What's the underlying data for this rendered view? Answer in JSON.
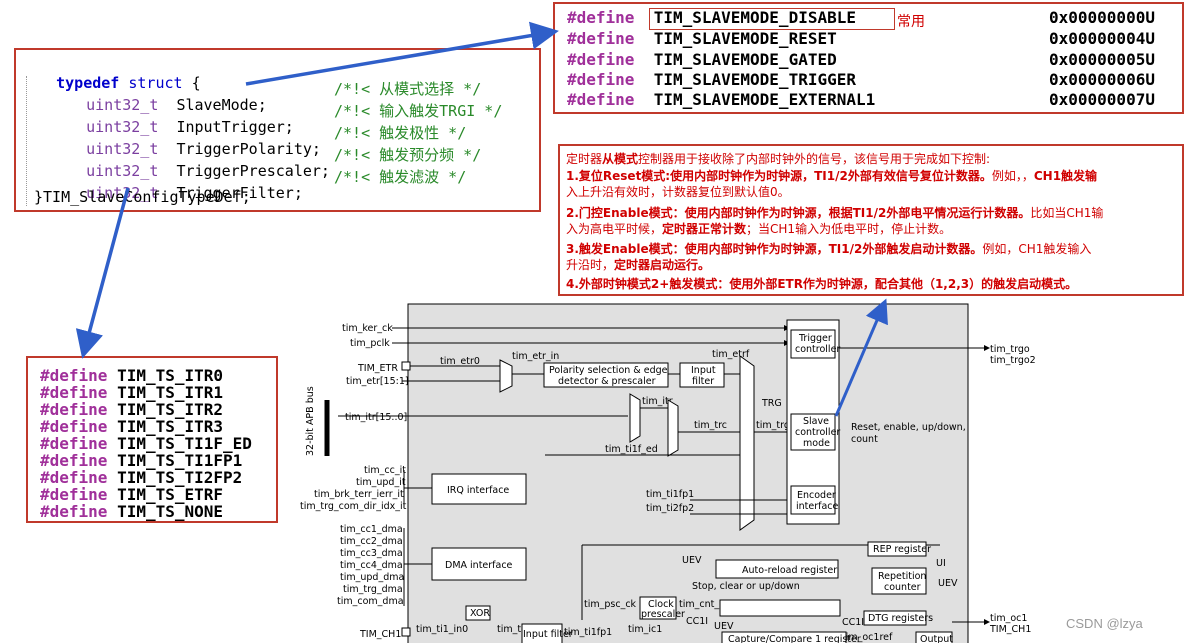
{
  "struct_box": {
    "typedef": "typedef",
    "struct": "struct",
    "brace_open": "{",
    "fields": [
      {
        "type": "uint32_t",
        "name": "SlaveMode;",
        "comment": "/*!< 从模式选择 */"
      },
      {
        "type": "uint32_t",
        "name": "InputTrigger;",
        "comment": "/*!< 输入触发TRGI */"
      },
      {
        "type": "uint32_t",
        "name": "TriggerPolarity;",
        "comment": "/*!< 触发极性 */"
      },
      {
        "type": "uint32_t",
        "name": "TriggerPrescaler;",
        "comment": "/*!< 触发预分频 */"
      },
      {
        "type": "uint32_t",
        "name": "TriggerFilter;",
        "comment": "/*!< 触发滤波 */"
      }
    ],
    "closing": "}TIM_SlaveConfigTypeDef;"
  },
  "slavemode_box": {
    "defines": [
      {
        "kw": "#define",
        "name": "TIM_SLAVEMODE_DISABLE",
        "value": "0x00000000U"
      },
      {
        "kw": "#define",
        "name": "TIM_SLAVEMODE_RESET",
        "value": "0x00000004U"
      },
      {
        "kw": "#define",
        "name": "TIM_SLAVEMODE_GATED",
        "value": "0x00000005U"
      },
      {
        "kw": "#define",
        "name": "TIM_SLAVEMODE_TRIGGER",
        "value": "0x00000006U"
      },
      {
        "kw": "#define",
        "name": "TIM_SLAVEMODE_EXTERNAL1",
        "value": "0x00000007U"
      }
    ],
    "note": "常用"
  },
  "ts_box": {
    "defines": [
      {
        "kw": "#define",
        "name": "TIM_TS_ITR0"
      },
      {
        "kw": "#define",
        "name": "TIM_TS_ITR1"
      },
      {
        "kw": "#define",
        "name": "TIM_TS_ITR2"
      },
      {
        "kw": "#define",
        "name": "TIM_TS_ITR3"
      },
      {
        "kw": "#define",
        "name": "TIM_TS_TI1F_ED"
      },
      {
        "kw": "#define",
        "name": "TIM_TS_TI1FP1"
      },
      {
        "kw": "#define",
        "name": "TIM_TS_TI2FP2"
      },
      {
        "kw": "#define",
        "name": "TIM_TS_ETRF"
      },
      {
        "kw": "#define",
        "name": "TIM_TS_NONE"
      }
    ]
  },
  "desc_box": {
    "intro_a": "定时器",
    "intro_b": "从模式",
    "intro_c": "控制器用于接收除了内部时钟外的信号，该信号用于完成如下控制:",
    "l1a": "1.复位Reset模式:使用内部时钟作为时钟源，TI1/2外部有效信号复位计数器。",
    "l1b": "例如，，",
    "l1c": "CH1触发输",
    "l2": "入上升沿有效时，计数器复位到默认值0。",
    "l3a": "2.门控Enable模式：使用内部时钟作为时钟源，根据TI1/2外部电平情况运行计数器。",
    "l3b": "比如当CH1输",
    "l4a": "入为高电平时候，",
    "l4b": "定时器正常计数",
    "l4c": "；当CH1输入为低电平时，停止计数。",
    "l5a": "3.触发Enable模式：使用内部时钟作为时钟源，",
    "l5b": "TI1/2外部触发启动计数器。",
    "l5c": "例如，CH1触发输入",
    "l6a": "升沿时，",
    "l6b": "定时器启动运行。",
    "l7": "4.外部时钟模式2+触发模式：使用外部ETR作为时钟源，配合其他（1,2,3）的触发启动模式。"
  },
  "diagram": {
    "inputs": {
      "tim_ker_ck": "tim_ker_ck",
      "tim_pclk": "tim_pclk",
      "tim_etr": "TIM_ETR",
      "tim_etr_bus": "tim_etr[15:1]",
      "tim_itr": "tim_itr[15..0]",
      "bus": "32-bit APB bus",
      "tim_cc_it": "tim_cc_it",
      "tim_upd_it": "tim_upd_it",
      "tim_brk": "tim_brk_terr_ierr_it",
      "tim_trg_com": "tim_trg_com_dir_idx_it",
      "tim_cc1_dma": "tim_cc1_dma",
      "tim_cc2_dma": "tim_cc2_dma",
      "tim_cc3_dma": "tim_cc3_dma",
      "tim_cc4_dma": "tim_cc4_dma",
      "tim_upd_dma": "tim_upd_dma",
      "tim_trg_dma": "tim_trg_dma",
      "tim_com_dma": "tim_com_dma",
      "tim_ch1": "TIM_CH1"
    },
    "signals": {
      "tim_etr0": "tim_etr0",
      "tim_etr_in": "tim_etr_in",
      "tim_etrf": "tim_etrf",
      "tim_itr_sig": "tim_itr",
      "tim_trc": "tim_trc",
      "tim_ti1f_ed": "tim_ti1f_ed",
      "tim_ti1fp1": "tim_ti1fp1",
      "tim_ti2fp2": "tim_ti2fp2",
      "trg": "TRG",
      "tim_trgi": "tim_trgi",
      "reset_label": "Reset, enable, up/down,",
      "count_label": "count",
      "uev": "UEV",
      "stop_label": "Stop, clear or up/down",
      "ui": "UI",
      "uev2": "UEV",
      "tim_psc_ck": "tim_psc_ck",
      "tim_cnt_ck": "tim_cnt_ck",
      "cc1i": "CC1I",
      "uev3": "UEV",
      "cc1i_b": "CC1I",
      "tim_ti1_in0": "tim_ti1_in0",
      "tim_ti1": "tim_ti1",
      "tim_ti1fp1_b": "tim_ti1fp1",
      "tim_ic1": "tim_ic1",
      "tim_oc1ref": "tim_oc1ref"
    },
    "blocks": {
      "polarity1": "Polarity selection & edge",
      "polarity2": "detector & prescaler",
      "input_filter1": "Input",
      "input_filter2": "filter",
      "trigger_ctrl1": "Trigger",
      "trigger_ctrl2": "controller",
      "slave1": "Slave",
      "slave2": "controller",
      "slave3": "mode",
      "encoder1": "Encoder",
      "encoder2": "interface",
      "irq": "IRQ interface",
      "dma": "DMA interface",
      "autoreload": "Auto-reload register",
      "rep_reg": "REP register",
      "rep_cnt1": "Repetition",
      "rep_cnt2": "counter",
      "clock_psc1": "Clock",
      "clock_psc2": "prescaler",
      "dtg": "DTG registers",
      "xor": "XOR",
      "input_filter_b": "Input filter",
      "ccr": "Capture/Compare 1 register",
      "output": "Output"
    },
    "outputs": {
      "tim_trgo": "tim_trgo",
      "tim_trgo2": "tim_trgo2",
      "tim_oc1": "tim_oc1",
      "tim_ch1_out": "TIM_CH1"
    }
  },
  "watermark": "CSDN @lzya"
}
